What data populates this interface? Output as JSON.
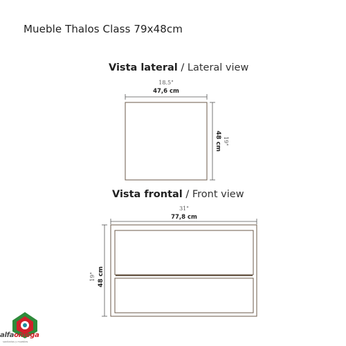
{
  "title": "Mueble Thalos Class 79x48cm",
  "lateral": {
    "heading_es": "Vista lateral",
    "heading_sep": " / ",
    "heading_en": "Lateral view",
    "width_in": "18.5\"",
    "width_cm": "47,6 cm",
    "height_in": "19\"",
    "height_cm": "48 cm"
  },
  "frontal": {
    "heading_es": "Vista frontal",
    "heading_sep": " / ",
    "heading_en": "Front view",
    "width_in": "31\"",
    "width_cm": "77,8 cm",
    "height_in": "19\"",
    "height_cm": "48 cm"
  },
  "brand": {
    "name_a": "alfa",
    "name_b": "omega",
    "tagline": "sanitarios y muebles",
    "colors": {
      "red": "#d0202a",
      "green": "#2e8b3a",
      "teal": "#1e8fa0"
    }
  },
  "colors": {
    "line": "#6b5a4a",
    "dim": "#555555"
  }
}
